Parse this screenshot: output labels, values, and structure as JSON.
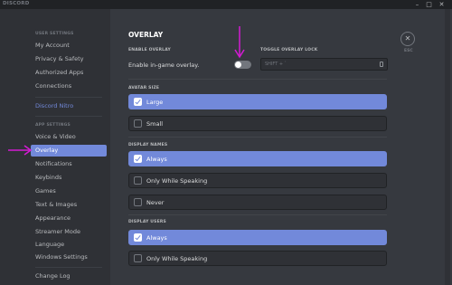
{
  "app": {
    "title": "DISCORD",
    "controls": {
      "minimize": "–",
      "maximize": "□",
      "close": "✕"
    }
  },
  "sidebar": {
    "user_settings_header": "USER SETTINGS",
    "user_items": [
      {
        "label": "My Account"
      },
      {
        "label": "Privacy & Safety"
      },
      {
        "label": "Authorized Apps"
      },
      {
        "label": "Connections"
      }
    ],
    "nitro_label": "Discord Nitro",
    "app_settings_header": "APP SETTINGS",
    "app_items": [
      {
        "label": "Voice & Video"
      },
      {
        "label": "Overlay",
        "selected": true
      },
      {
        "label": "Notifications"
      },
      {
        "label": "Keybinds"
      },
      {
        "label": "Games"
      },
      {
        "label": "Text & Images"
      },
      {
        "label": "Appearance"
      },
      {
        "label": "Streamer Mode"
      },
      {
        "label": "Language"
      },
      {
        "label": "Windows Settings"
      }
    ],
    "changelog_label": "Change Log"
  },
  "main": {
    "title": "OVERLAY",
    "enable_overlay_header": "ENABLE OVERLAY",
    "enable_overlay_label": "Enable in-game overlay.",
    "enable_overlay_on": false,
    "toggle_lock_header": "TOGGLE OVERLAY LOCK",
    "toggle_lock_keybind": "SHIFT + `",
    "avatar_size": {
      "header": "AVATAR SIZE",
      "options": [
        {
          "label": "Large",
          "selected": true
        },
        {
          "label": "Small",
          "selected": false
        }
      ]
    },
    "display_names": {
      "header": "DISPLAY NAMES",
      "options": [
        {
          "label": "Always",
          "selected": true
        },
        {
          "label": "Only While Speaking",
          "selected": false
        },
        {
          "label": "Never",
          "selected": false
        }
      ]
    },
    "display_users": {
      "header": "DISPLAY USERS",
      "options": [
        {
          "label": "Always",
          "selected": true
        },
        {
          "label": "Only While Speaking",
          "selected": false
        }
      ]
    },
    "esc_label": "ESC"
  },
  "colors": {
    "accent": "#7289da",
    "annotation_arrow": "#d41bd4",
    "background": "#36393f",
    "sidebar": "#2f3136"
  },
  "icons": {
    "close": "close-icon",
    "checkmark": "checkmark-icon",
    "keybind_edit": "keyboard-icon"
  }
}
